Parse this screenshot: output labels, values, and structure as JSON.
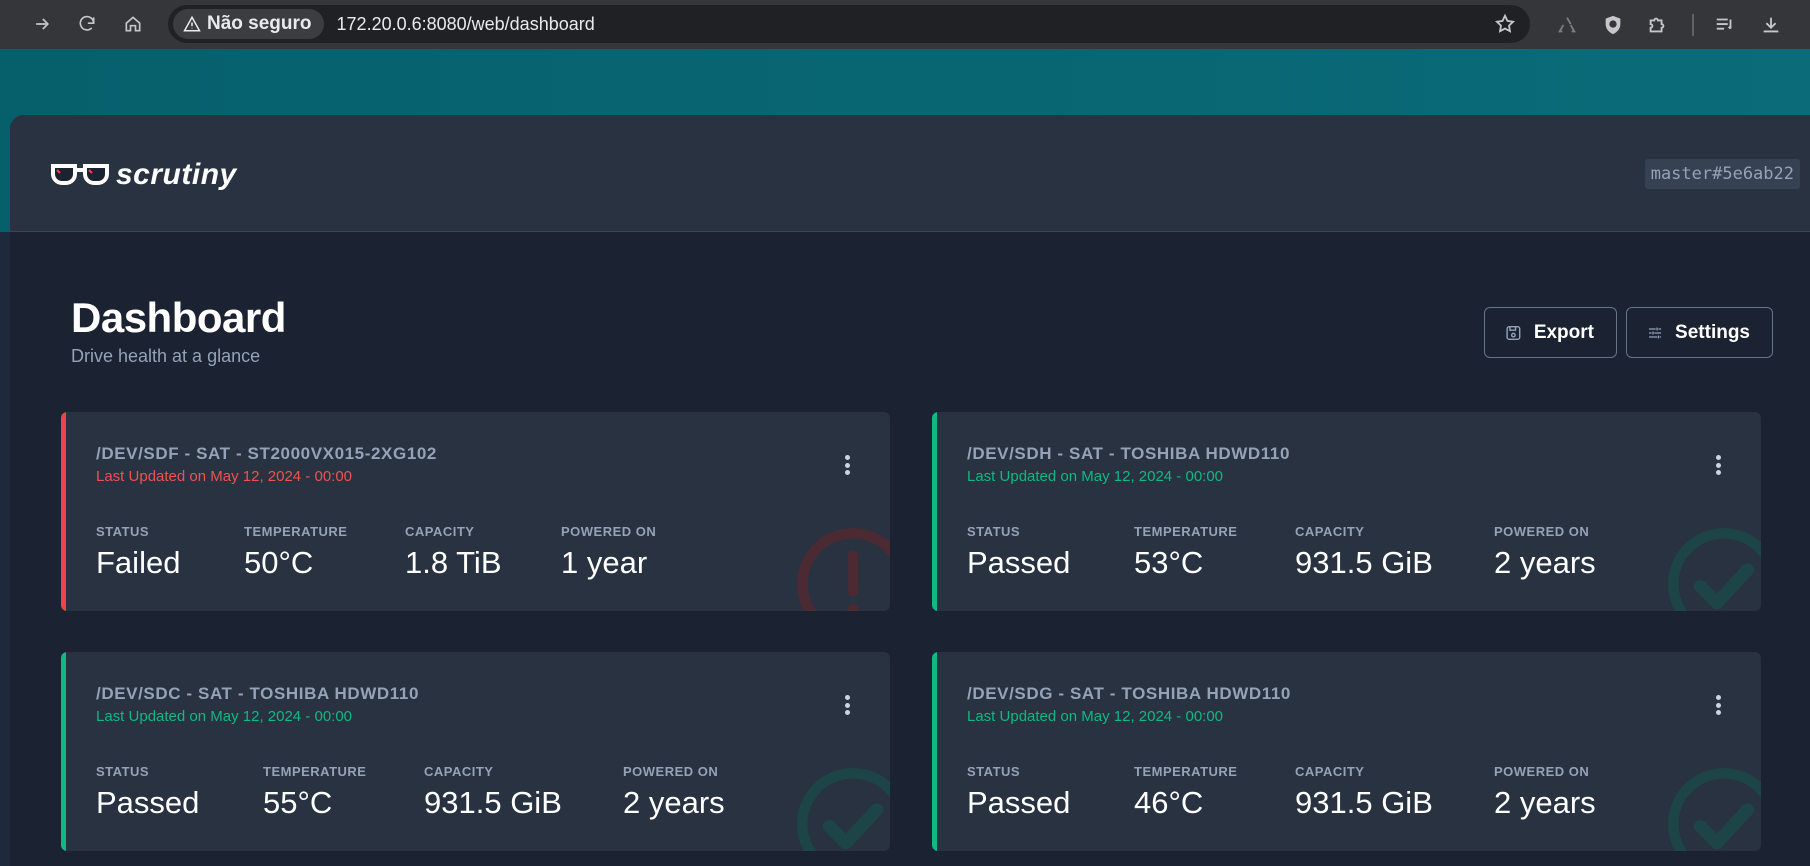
{
  "browser": {
    "security_label": "Não seguro",
    "url": "172.20.0.6:8080/web/dashboard"
  },
  "app": {
    "logo_text": "scrutiny",
    "version": "master#5e6ab22"
  },
  "page": {
    "title": "Dashboard",
    "subtitle": "Drive health at a glance",
    "export_label": "Export",
    "settings_label": "Settings"
  },
  "colors": {
    "failed": "#ef4444",
    "passed": "#10b981",
    "teal": "#0b6b78"
  },
  "stat_labels": {
    "status": "STATUS",
    "temperature": "TEMPERATURE",
    "capacity": "CAPACITY",
    "powered_on": "POWERED ON"
  },
  "drives": [
    {
      "device": "/DEV/SDF - SAT - ST2000VX015-2XG102",
      "updated": "Last Updated on May 12, 2024 - 00:00",
      "status": "Failed",
      "temperature": "50°C",
      "capacity": "1.8 TiB",
      "powered_on": "1 year",
      "state_icon": "alert-icon"
    },
    {
      "device": "/DEV/SDH - SAT - TOSHIBA HDWD110",
      "updated": "Last Updated on May 12, 2024 - 00:00",
      "status": "Passed",
      "temperature": "53°C",
      "capacity": "931.5 GiB",
      "powered_on": "2 years",
      "state_icon": "check-icon"
    },
    {
      "device": "/DEV/SDC - SAT - TOSHIBA HDWD110",
      "updated": "Last Updated on May 12, 2024 - 00:00",
      "status": "Passed",
      "temperature": "55°C",
      "capacity": "931.5 GiB",
      "powered_on": "2 years",
      "state_icon": "check-icon"
    },
    {
      "device": "/DEV/SDG - SAT - TOSHIBA HDWD110",
      "updated": "Last Updated on May 12, 2024 - 00:00",
      "status": "Passed",
      "temperature": "46°C",
      "capacity": "931.5 GiB",
      "powered_on": "2 years",
      "state_icon": "check-icon"
    }
  ]
}
